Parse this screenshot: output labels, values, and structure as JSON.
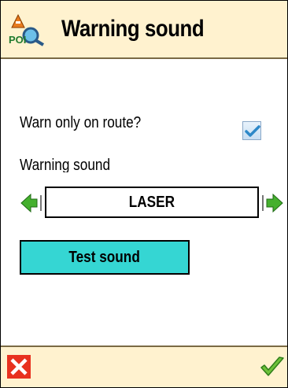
{
  "header": {
    "title": "Warning sound",
    "icon": "poi-icon"
  },
  "settings": {
    "warn_only_on_route_label": "Warn only on route?",
    "warn_only_on_route_checked": true,
    "warning_sound_label": "Warning sound",
    "warning_sound_value": "LASER",
    "prev_icon": "arrow-left-icon",
    "next_icon": "arrow-right-icon",
    "test_sound_label": "Test sound"
  },
  "footer": {
    "cancel_icon": "cancel-icon",
    "confirm_icon": "checkmark-icon"
  },
  "colors": {
    "header_bg": "#fff2cf",
    "button_bg": "#35d6d3",
    "arrow_green": "#45b02e",
    "cancel_red": "#e8311f",
    "check_blue": "#2d88c8"
  }
}
